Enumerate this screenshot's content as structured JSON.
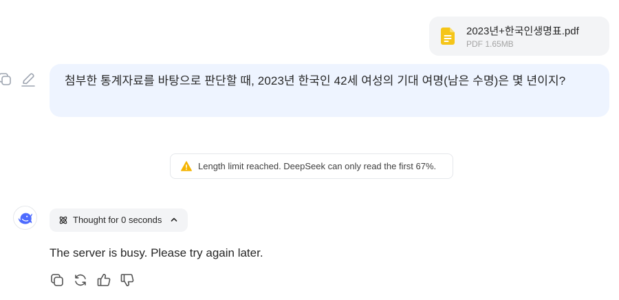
{
  "attachment": {
    "file_name": "2023년+한국인생명표.pdf",
    "meta": "PDF 1.65MB",
    "icon": "document-icon",
    "icon_color": "#f5c518"
  },
  "user_message": {
    "text": "첨부한 통계자료를 바탕으로 판단할 때, 2023년 한국인 42세 여성의 기대 여명(남은 수명)은 몇 년이지?",
    "actions": [
      "copy-icon",
      "edit-icon"
    ]
  },
  "notice": {
    "icon": "warning-icon",
    "text": "Length limit reached. DeepSeek can only read the first 67%."
  },
  "assistant": {
    "avatar": "deepseek-logo-icon",
    "accent_color": "#4d6bfe",
    "thought_label": "Thought for 0 seconds",
    "reply_text": "The server is busy. Please try again later.",
    "actions": [
      "copy-icon",
      "regenerate-icon",
      "thumbs-up-icon",
      "thumbs-down-icon"
    ]
  },
  "colors": {
    "user_bubble": "#eef4ff",
    "chip_background": "#f3f4f6",
    "warning": "#f5b400"
  }
}
